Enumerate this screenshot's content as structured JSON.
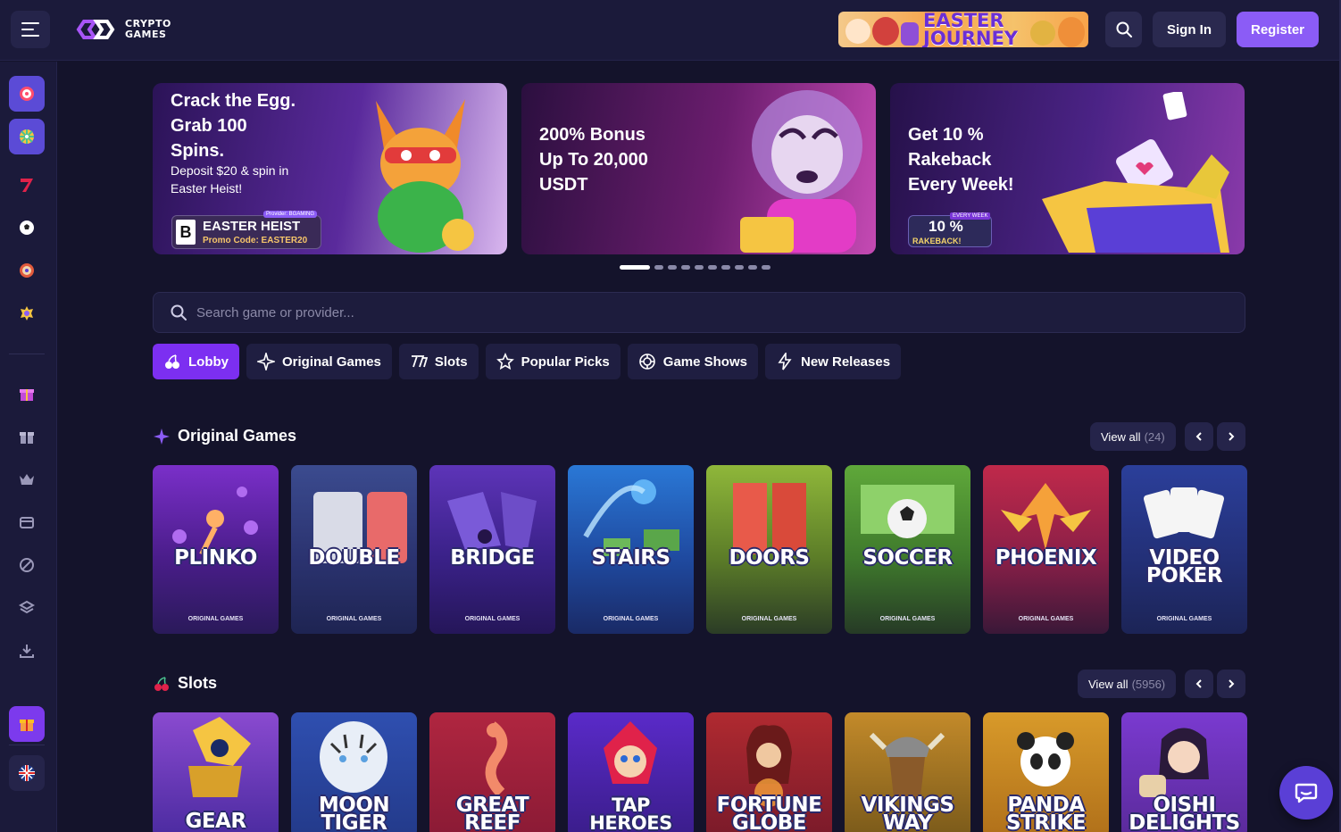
{
  "header": {
    "logo_line1": "CRYPTO",
    "logo_line2": "GAMES",
    "promo_banner": "EASTER JOURNEY",
    "sign_in": "Sign In",
    "register": "Register",
    "accent": "#8b5cf6"
  },
  "sidebar": {
    "items": [
      {
        "icon": "target-icon"
      },
      {
        "icon": "wheel-icon"
      },
      {
        "icon": "slot-seven-icon"
      },
      {
        "icon": "soccer-ball-icon"
      },
      {
        "icon": "roulette-icon"
      },
      {
        "icon": "live-casino-icon"
      },
      {
        "icon": "gift-box-icon"
      },
      {
        "icon": "gift-icon"
      },
      {
        "icon": "crown-icon"
      },
      {
        "icon": "ticket-icon"
      },
      {
        "icon": "no-sign-icon"
      },
      {
        "icon": "layers-icon"
      },
      {
        "icon": "download-icon"
      },
      {
        "icon": "rewards-icon"
      },
      {
        "icon": "uk-flag-icon"
      }
    ]
  },
  "carousel": {
    "slides": [
      {
        "title": "Crack the Egg. Grab 100 Spins.",
        "title_lines": [
          "Crack the Egg.",
          "Grab 100",
          "Spins."
        ],
        "subtitle_lines": [
          "Deposit $20 & spin in",
          "Easter Heist!"
        ],
        "badge_letter": "B",
        "badge_name": "EASTER HEIST",
        "badge_promo": "Promo Code: EASTER20",
        "badge_provider": "Provider: BGAMING"
      },
      {
        "title_lines": [
          "200% Bonus",
          "Up To 20,000",
          "USDT"
        ]
      },
      {
        "title_lines": [
          "Get 10 %",
          "Rakeback",
          "Every Week!"
        ],
        "badge_top": "EVERY WEEK",
        "badge_pct": "10 %",
        "badge_label": "RAKEBACK!"
      }
    ],
    "dots_count": 10,
    "active_dot": 0
  },
  "search": {
    "placeholder": "Search game or provider..."
  },
  "tabs": [
    {
      "label": "Lobby",
      "icon": "cherries-icon",
      "active": true
    },
    {
      "label": "Original Games",
      "icon": "sparkle-icon",
      "active": false
    },
    {
      "label": "Slots",
      "icon": "slot-sevens-icon",
      "active": false
    },
    {
      "label": "Popular Picks",
      "icon": "star-icon",
      "active": false
    },
    {
      "label": "Game Shows",
      "icon": "game-show-icon",
      "active": false
    },
    {
      "label": "New Releases",
      "icon": "lightning-icon",
      "active": false
    }
  ],
  "original_games": {
    "title": "Original Games",
    "view_all": "View all",
    "count": "(24)",
    "games": [
      {
        "name": "PLINKO",
        "category": "ORIGINAL GAMES"
      },
      {
        "name": "DOUBLE",
        "category": "ORIGINAL GAMES"
      },
      {
        "name": "BRIDGE",
        "category": "ORIGINAL GAMES"
      },
      {
        "name": "STAIRS",
        "category": "ORIGINAL GAMES"
      },
      {
        "name": "DOORS",
        "category": "ORIGINAL GAMES"
      },
      {
        "name": "SOCCER",
        "category": "ORIGINAL GAMES"
      },
      {
        "name": "PHOENIX",
        "category": "ORIGINAL GAMES"
      },
      {
        "name_line1": "VIDEO",
        "name_line2": "POKER",
        "category": "ORIGINAL GAMES"
      }
    ]
  },
  "slots": {
    "title": "Slots",
    "view_all": "View all",
    "count": "(5956)",
    "games": [
      {
        "name": "GEAR"
      },
      {
        "name_line1": "MOON",
        "name_line2": "TIGER"
      },
      {
        "name_line1": "GREAT",
        "name_line2": "REEF"
      },
      {
        "name": "TAP HEROES"
      },
      {
        "name_line1": "FORTUNE",
        "name_line2": "GLOBE"
      },
      {
        "name_line1": "VIKINGS",
        "name_line2": "WAY"
      },
      {
        "name_line1": "PANDA",
        "name_line2": "STRIKE"
      },
      {
        "name_line1": "OISHI",
        "name_line2": "DELIGHTS"
      }
    ]
  }
}
